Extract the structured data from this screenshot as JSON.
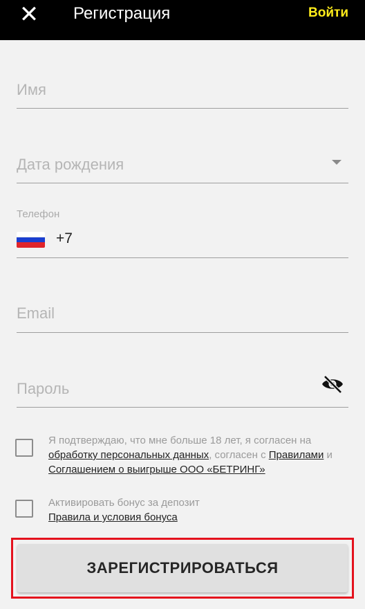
{
  "header": {
    "close_icon": "close-icon",
    "title": "Регистрация",
    "login_label": "Войти",
    "login_color": "#ffec1a"
  },
  "form": {
    "name_placeholder": "Имя",
    "dob_placeholder": "Дата рождения",
    "dob_icon": "dropdown-arrow-icon",
    "phone_label": "Телефон",
    "phone_country_icon": "russia-flag-icon",
    "phone_code": "+7",
    "email_placeholder": "Email",
    "password_placeholder": "Пароль",
    "password_toggle_icon": "eye-off-icon"
  },
  "agreements": {
    "age_consent": {
      "text_1": "Я подтверждаю, что мне больше 18 лет, я согласен на",
      "link_personal_data": "обработку персональных данных",
      "text_2": ", согласен с",
      "link_rules": "Правилами",
      "text_3": "и",
      "link_agreement": "Соглашением о выигрыше ООО «БЕТРИНГ»"
    },
    "bonus": {
      "text": "Активировать бонус за депозит",
      "link_terms": "Правила и условия бонуса"
    }
  },
  "submit_label": "ЗАРЕГИСТРИРОВАТЬСЯ",
  "highlight_color": "#e4121d"
}
